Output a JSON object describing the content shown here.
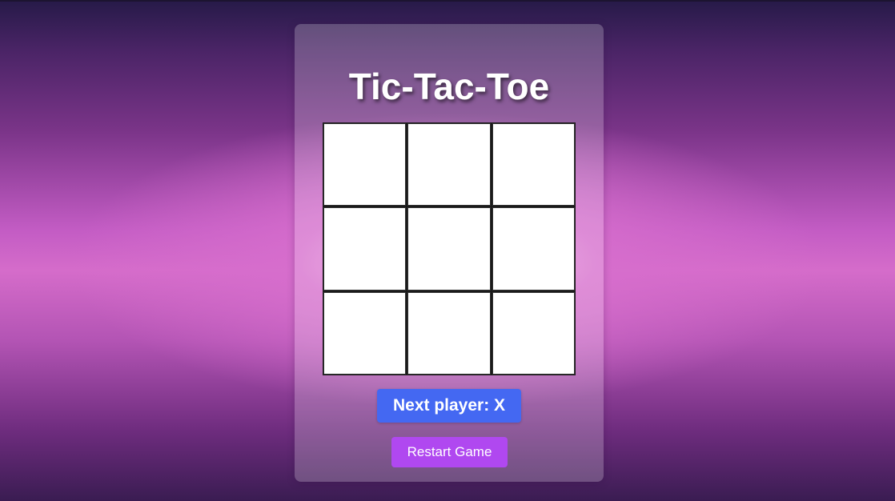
{
  "app": {
    "title": "Tic-Tac-Toe"
  },
  "board": {
    "cells": [
      "",
      "",
      "",
      "",
      "",
      "",
      "",
      "",
      ""
    ]
  },
  "status": {
    "text": "Next player: X"
  },
  "controls": {
    "restart_label": "Restart Game"
  },
  "colors": {
    "status_bg": "#4468f2",
    "restart_bg": "#b048f0",
    "cell_bg": "#ffffff",
    "grid_line": "#1a1a1a"
  }
}
